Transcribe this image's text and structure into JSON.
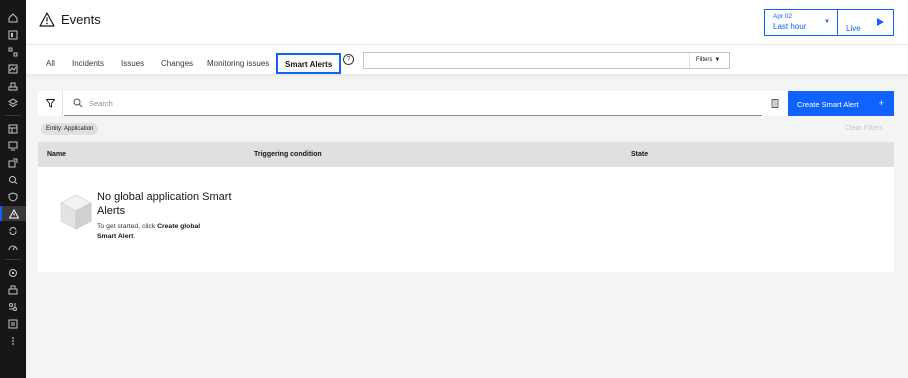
{
  "header": {
    "title": "Events",
    "time_picker": {
      "date": "Apr 02",
      "range": "Last hour"
    },
    "live_label": "Live"
  },
  "tabs": [
    {
      "label": "All"
    },
    {
      "label": "Incidents"
    },
    {
      "label": "Issues"
    },
    {
      "label": "Changes"
    },
    {
      "label": "Monitoring issues"
    },
    {
      "label": "Smart Alerts"
    }
  ],
  "top_search": {
    "filters_label": "Filters"
  },
  "toolbar": {
    "search_placeholder": "Search",
    "create_label": "Create Smart Alert",
    "create_icon": "+"
  },
  "entity_tag": "Entity: Application",
  "clear_filters": "Clear Filters",
  "table": {
    "columns": [
      "Name",
      "Triggering condition",
      "State"
    ]
  },
  "empty_state": {
    "title": "No global application Smart Alerts",
    "line1_prefix": "To get started, click ",
    "line1_bold": "Create global",
    "line2_bold": "Smart Alert",
    "line2_suffix": "."
  },
  "colors": {
    "accent": "#0f62fe",
    "rail": "#161616"
  }
}
